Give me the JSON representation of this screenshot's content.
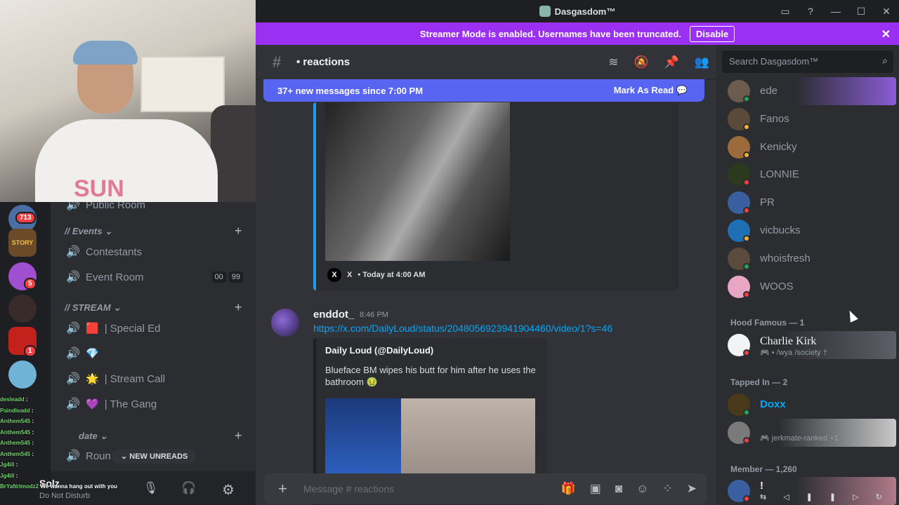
{
  "window": {
    "title": "Dasgasdom™"
  },
  "banner": {
    "text": "Streamer Mode is enabled. Usernames have been truncated.",
    "button": "Disable"
  },
  "webcam": {
    "shirt_text": "SUN"
  },
  "servers": [
    {
      "badge": "713",
      "color": "#4a6fa5"
    },
    {
      "badge": "",
      "color": "#6b4a2a",
      "label": "STORY"
    },
    {
      "badge": "5",
      "color": "#a14fd1"
    },
    {
      "badge": "",
      "color": "#3a2b2b"
    },
    {
      "badge": "1",
      "color": "#c4201c"
    },
    {
      "badge": "",
      "color": "#6fb3d6"
    }
  ],
  "channels": {
    "partial_top": "Public Room",
    "categories": [
      {
        "name": "// Events"
      },
      {
        "name": "// STREAM"
      },
      {
        "name": "date"
      }
    ],
    "items": [
      {
        "label": "Contestants",
        "counts": []
      },
      {
        "label": "Event Room",
        "counts": [
          "00",
          "99"
        ]
      },
      {
        "label": "| Special Ed",
        "emoji": "🟥"
      },
      {
        "label": "",
        "emoji": "💎"
      },
      {
        "label": "| Stream Call",
        "emoji": "🌟"
      },
      {
        "label": "| The Gang",
        "emoji": "💜"
      },
      {
        "label": "Roun",
        "emoji": ""
      }
    ],
    "new_unreads": "NEW UNREADS"
  },
  "user": {
    "name": "Solz",
    "status": "Do Not Disturb"
  },
  "stream_chat": [
    {
      "user": "desleadd",
      "text": ":"
    },
    {
      "user": "Paindleadd",
      "text": ":"
    },
    {
      "user": "Anthem545",
      "text": ":"
    },
    {
      "user": "Anthem545",
      "text": ":"
    },
    {
      "user": "Anthem545",
      "text": ":"
    },
    {
      "user": "Anthem545",
      "text": ":"
    },
    {
      "user": "Jg4ill",
      "text": ":"
    },
    {
      "user": "Jg4ill",
      "text": ":"
    },
    {
      "user": "BrYaNrtmodz2",
      "text": "We wanna hang out with you"
    }
  ],
  "channel": {
    "name": "reactions",
    "new_messages": "37+ new messages since 7:00 PM",
    "mark_read": "Mark As Read",
    "embed1": {
      "source": "X",
      "time": "• Today at 4:00 AM"
    },
    "message": {
      "author": "enddot_",
      "time": "8:46 PM",
      "link": "https://x.com/DailyLoud/status/2048056923941904460/video/1?s=46",
      "embed_provider": "Daily Loud (@DailyLoud)",
      "embed_desc": "Blueface BM wipes his butt for him after he uses the bathroom 🤢"
    },
    "composer_placeholder": "Message # reactions"
  },
  "members": {
    "search_placeholder": "Search Dasgasdom™",
    "top": [
      {
        "name": "ede",
        "status": "#23a55a",
        "color": "#6b5c4f"
      },
      {
        "name": "Fanos",
        "status": "#f0b232",
        "color": "#5a4a3a"
      },
      {
        "name": "Kenicky",
        "status": "#f0b232",
        "color": "#9c6b3c"
      },
      {
        "name": "LONNIE",
        "status": "#f23f43",
        "color": "#2b3a1c"
      },
      {
        "name": "PR",
        "status": "#f23f43",
        "color": "#3a5fa0"
      },
      {
        "name": "vicbucks",
        "status": "#f0b232",
        "color": "#1f6fb5"
      },
      {
        "name": "whoisfresh",
        "status": "#23a55a",
        "color": "#5a4b3c"
      },
      {
        "name": "WOOS",
        "status": "#f23f43",
        "color": "#e9a5c4"
      }
    ],
    "groups": [
      {
        "label": "Hood Famous — 1"
      },
      {
        "label": "Tapped In — 2"
      },
      {
        "label": "Member — 1,260"
      }
    ],
    "hood": {
      "name": "Charlie Kirk",
      "activity": "• /wya /society †"
    },
    "tapped": [
      {
        "name": "Doxx",
        "activity": ""
      },
      {
        "name": "",
        "activity": "jerkmate-ranked +1"
      }
    ],
    "bottom": {
      "name": "!"
    }
  }
}
